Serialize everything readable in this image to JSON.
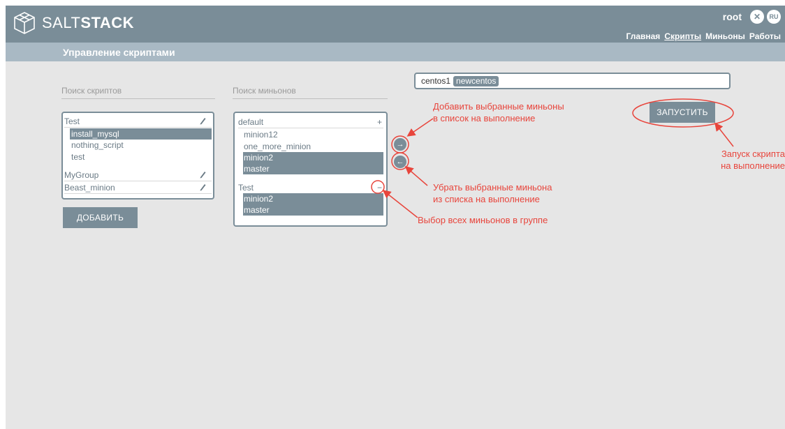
{
  "header": {
    "logo_prefix": "SALT",
    "logo_suffix": "STACK",
    "username": "root",
    "logout_icon": "close-icon",
    "lang": "RU",
    "nav": [
      {
        "label": "Главная",
        "active": false
      },
      {
        "label": "Скрипты",
        "active": true
      },
      {
        "label": "Миньоны",
        "active": false
      },
      {
        "label": "Работы",
        "active": false
      }
    ]
  },
  "subheader": {
    "title": "Управление скриптами"
  },
  "scripts": {
    "search_placeholder": "Поиск скриптов",
    "groups": [
      {
        "name": "Test",
        "items": [
          "install_mysql",
          "nothing_script",
          "test"
        ],
        "selected": "install_mysql"
      },
      {
        "name": "MyGroup",
        "items": []
      },
      {
        "name": "Beast_minion",
        "items": []
      }
    ],
    "add_button": "ДОБАВИТЬ"
  },
  "minions": {
    "search_placeholder": "Поиск миньонов",
    "groups": [
      {
        "name": "default",
        "action": "+",
        "items": [
          "minion12",
          "one_more_minion",
          "minion2",
          "master"
        ],
        "selected": [
          "minion2",
          "master"
        ]
      },
      {
        "name": "Test",
        "action": "−",
        "items": [
          "minion2",
          "master"
        ],
        "selected": [
          "minion2",
          "master"
        ]
      }
    ],
    "add_arrow": "→",
    "remove_arrow": "←"
  },
  "run": {
    "targets": [
      "centos1"
    ],
    "target_tags": [
      "newcentos"
    ],
    "run_button": "ЗАПУСТИТЬ"
  },
  "annotations": {
    "add_selected_line1": "Добавить выбранные миньоны",
    "add_selected_line2": "в список на выполнение",
    "remove_selected_line1": "Убрать выбранные миньона",
    "remove_selected_line2": "из списка на выполнение",
    "select_all": "Выбор всех миньонов в группе",
    "run_line1": "Запуск скрипта",
    "run_line2": "на выполнение",
    "color": "#e8453c"
  },
  "colors": {
    "accent": "#7a8d98",
    "subbar": "#a9b9c4",
    "background": "#e6e6e6"
  }
}
